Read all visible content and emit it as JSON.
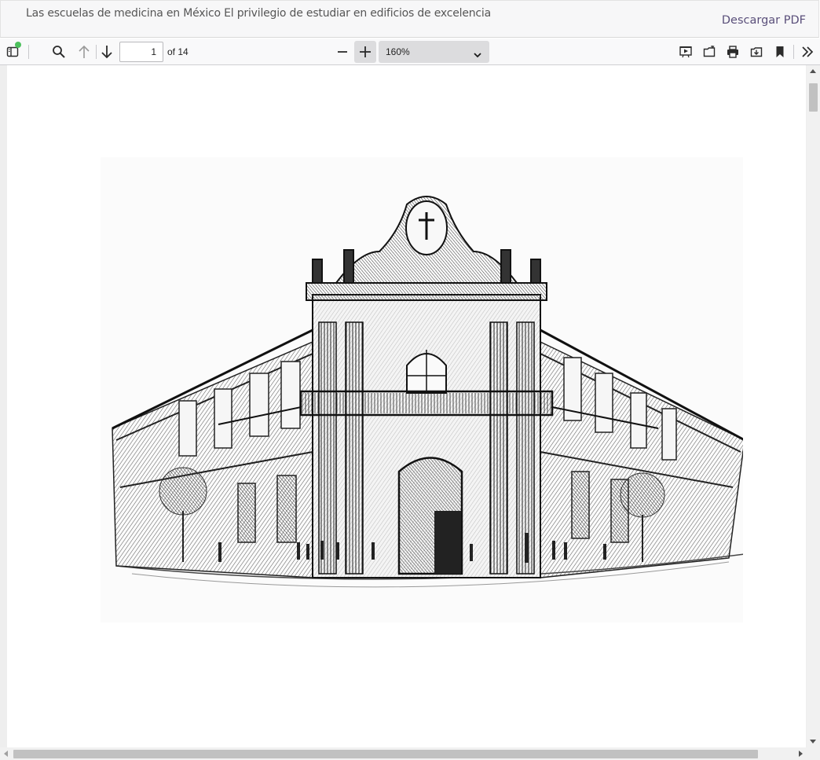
{
  "header": {
    "title": "Las escuelas de medicina en México El privilegio de estudiar en edificios de excelencia",
    "download_label": "Descargar PDF"
  },
  "toolbar": {
    "page_number": "1",
    "page_count_label": "of 14",
    "zoom": "160%",
    "icons": {
      "sidebar": "sidebar-toggle-icon",
      "find": "search-icon",
      "prev": "arrow-up-icon",
      "next": "arrow-down-icon",
      "zoom_out": "minus-icon",
      "zoom_in": "plus-icon",
      "presentation": "presentation-mode-icon",
      "open": "open-file-icon",
      "print": "print-icon",
      "save": "download-icon",
      "bookmark": "bookmark-icon",
      "tools": "double-chevron-right-icon"
    },
    "status_dot_color": "#4cc05c"
  },
  "document": {
    "illustration": "ink sketch of a colonial corner building",
    "scroll": {
      "vertical_position": 0.0,
      "horizontal_position": 0.0
    }
  },
  "colors": {
    "accent_link": "#5a4f7a",
    "toolbar_bg": "#f9f9fa",
    "header_bg": "#f7f7f8"
  }
}
